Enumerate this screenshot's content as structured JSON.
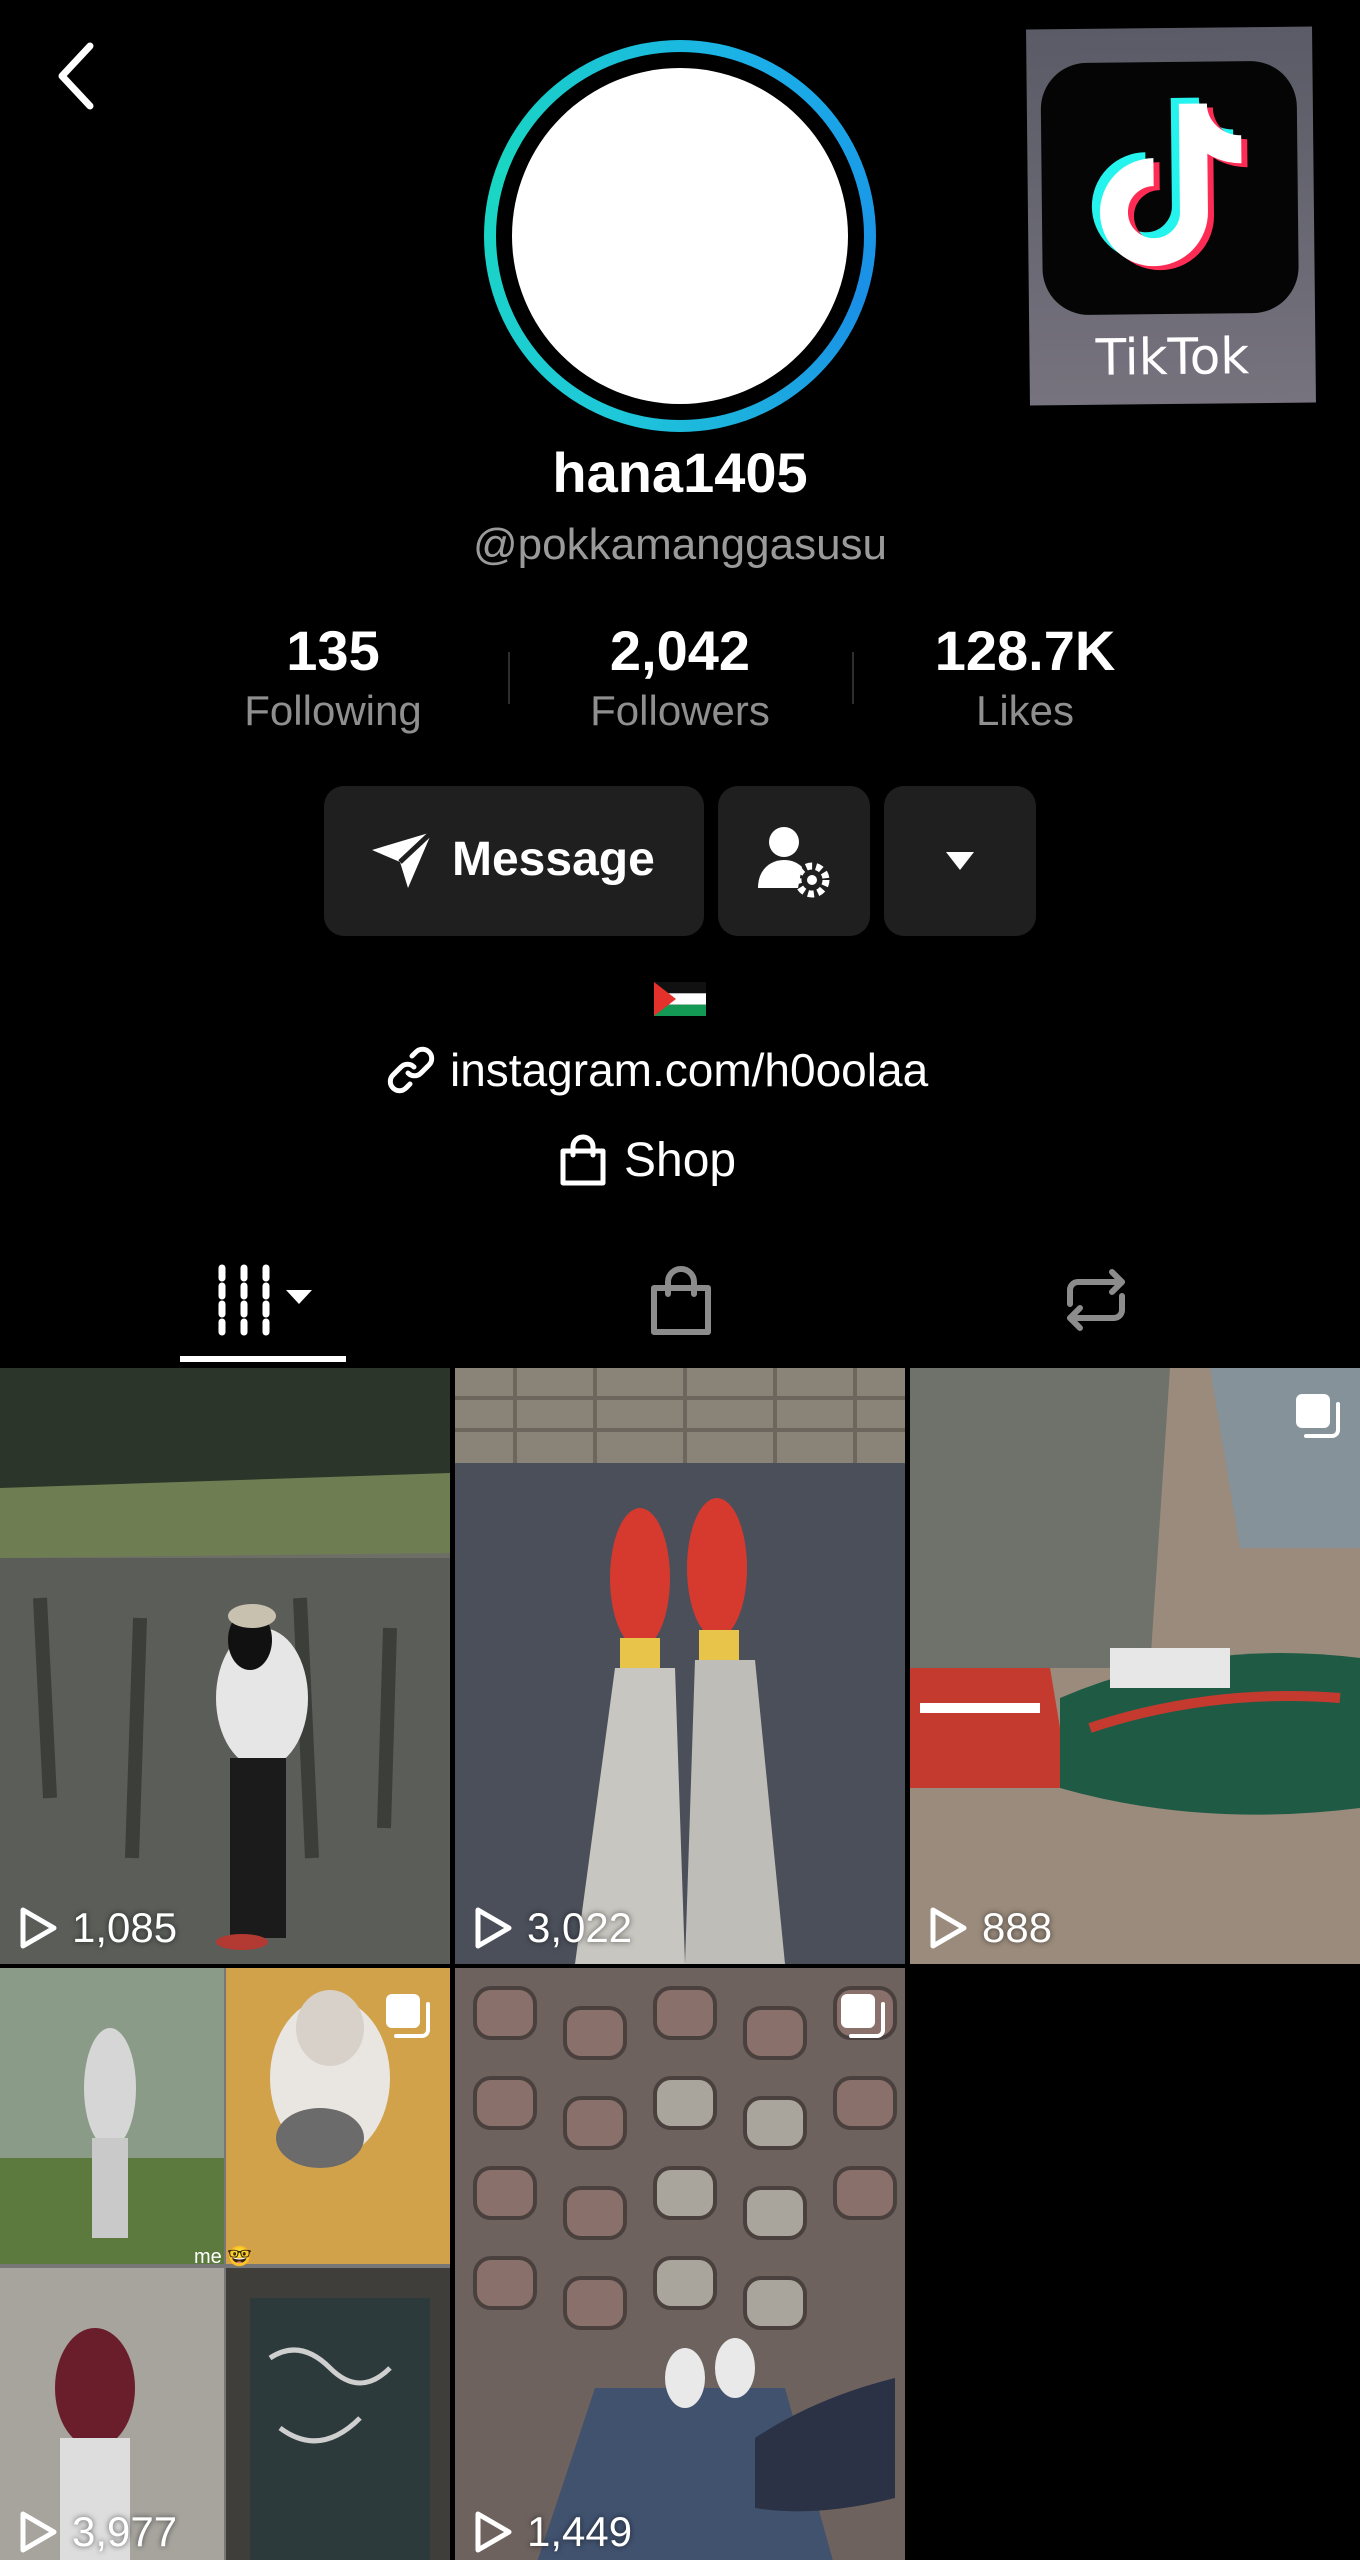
{
  "profile": {
    "username": "hana1405",
    "handle": "@pokkamanggasusu",
    "badge_text": "TikTok"
  },
  "stats": [
    {
      "value": "135",
      "label": "Following"
    },
    {
      "value": "2,042",
      "label": "Followers"
    },
    {
      "value": "128.7K",
      "label": "Likes"
    }
  ],
  "actions": {
    "message_label": "Message"
  },
  "bio": {
    "link_text": "instagram.com/h0oolaa",
    "shop_label": "Shop"
  },
  "tabs": [
    {
      "icon": "videos-grid-icon",
      "active": true
    },
    {
      "icon": "shopping-bag-icon",
      "active": false
    },
    {
      "icon": "repost-icon",
      "active": false
    }
  ],
  "videos": [
    {
      "views": "1,085",
      "multi": false
    },
    {
      "views": "3,022",
      "multi": false
    },
    {
      "views": "888",
      "multi": true
    },
    {
      "views": "3,977",
      "multi": true,
      "caption": "me 🤓"
    },
    {
      "views": "1,449",
      "multi": true
    }
  ],
  "colors": {
    "background": "#000000",
    "button_bg": "#1f1f1f",
    "muted_text": "#8f8f8f",
    "ring_cyan": "#1ec8d9",
    "ring_blue": "#1a8fe6"
  }
}
